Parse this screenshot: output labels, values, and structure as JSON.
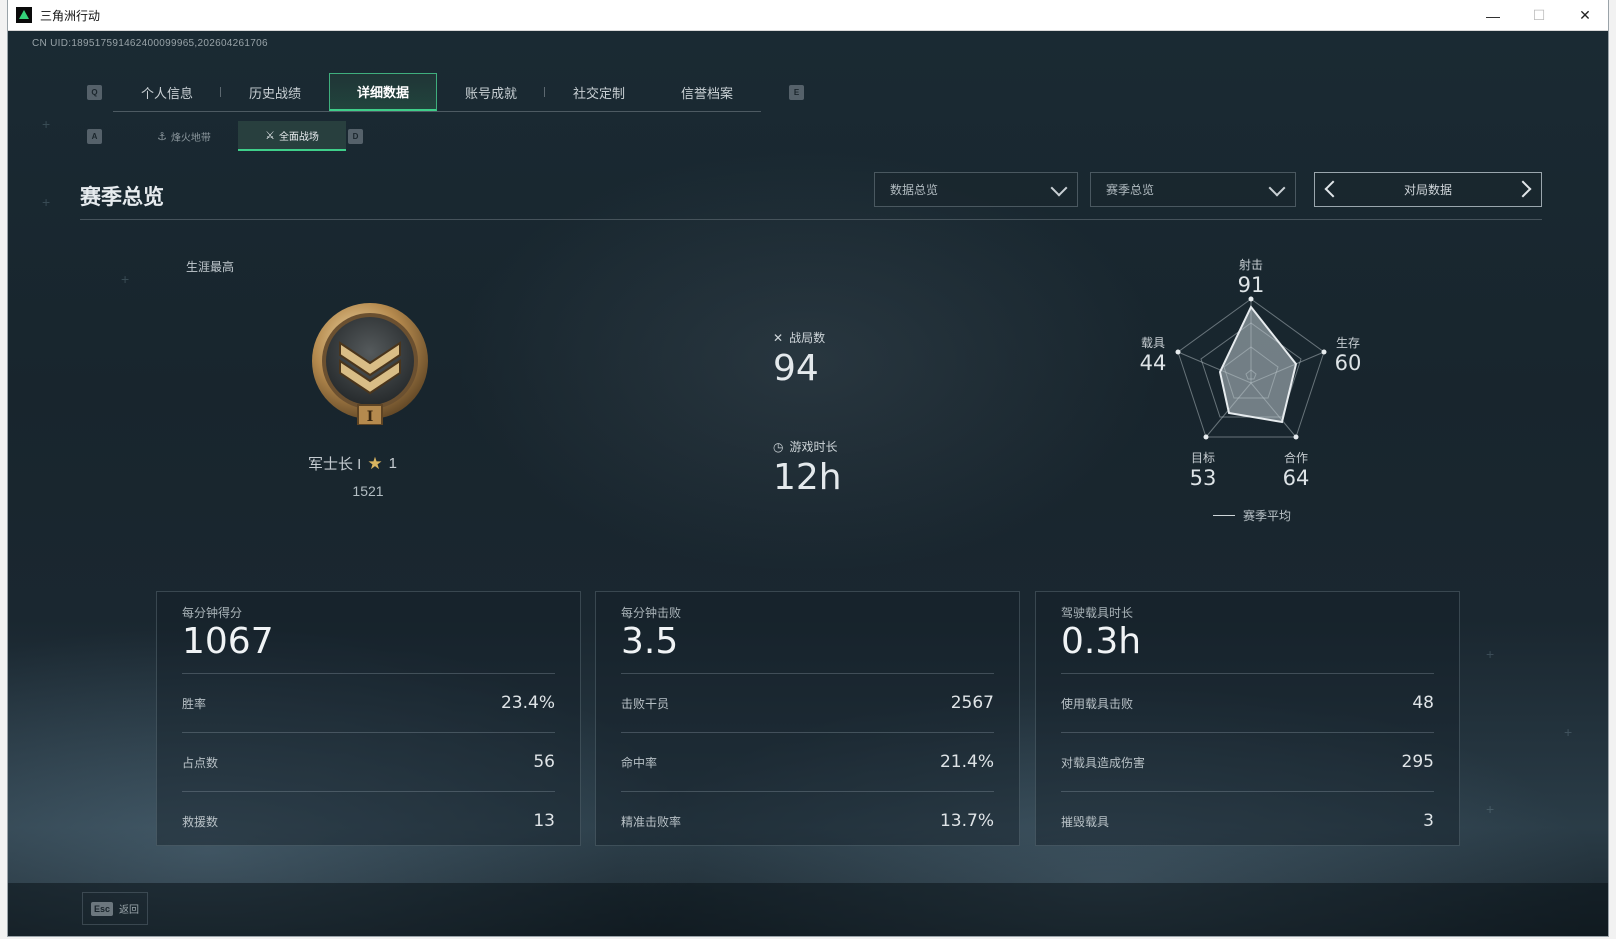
{
  "window": {
    "title": "三角洲行动",
    "minimize_icon": "minimize-icon",
    "maximize_icon": "maximize-icon",
    "close_icon": "close-icon"
  },
  "header": {
    "uid": "CN UID:1895175914624000999​65,202604261706"
  },
  "keys": {
    "prev_tab": "Q",
    "next_tab": "E",
    "prev_sub": "A",
    "next_sub": "D",
    "esc": "Esc"
  },
  "tabs": [
    {
      "label": "个人信息",
      "active": false
    },
    {
      "label": "历史战绩",
      "active": false
    },
    {
      "label": "详细数据",
      "active": true
    },
    {
      "label": "账号成就",
      "active": false
    },
    {
      "label": "社交定制",
      "active": false
    },
    {
      "label": "信誉档案",
      "active": false
    }
  ],
  "subtabs": [
    {
      "label": "烽火地带",
      "active": false
    },
    {
      "label": "全面战场",
      "active": true
    }
  ],
  "section": {
    "title": "赛季总览"
  },
  "filters": {
    "data_dropdown": "数据总览",
    "season_dropdown": "赛季总览",
    "pager_label": "对局数据"
  },
  "rank": {
    "career_label": "生涯最高",
    "name": "军士长 I",
    "stars": "1",
    "score": "1521"
  },
  "summary": {
    "matches_label": "战局数",
    "matches_value": "94",
    "playtime_label": "游戏时长",
    "playtime_value": "12h"
  },
  "radar": {
    "axes": [
      {
        "name": "射击",
        "value": "91"
      },
      {
        "name": "生存",
        "value": "60"
      },
      {
        "name": "合作",
        "value": "64"
      },
      {
        "name": "目标",
        "value": "53"
      },
      {
        "name": "载具",
        "value": "44"
      }
    ],
    "legend": "赛季平均"
  },
  "cards": [
    {
      "head_label": "每分钟得分",
      "head_value": "1067",
      "rows": [
        {
          "k": "胜率",
          "v": "23.4%"
        },
        {
          "k": "占点数",
          "v": "56"
        },
        {
          "k": "救援数",
          "v": "13"
        }
      ]
    },
    {
      "head_label": "每分钟击败",
      "head_value": "3.5",
      "rows": [
        {
          "k": "击败干员",
          "v": "2567"
        },
        {
          "k": "命中率",
          "v": "21.4%"
        },
        {
          "k": "精准击败率",
          "v": "13.7%"
        }
      ]
    },
    {
      "head_label": "驾驶载具时长",
      "head_value": "0.3h",
      "rows": [
        {
          "k": "使用载具击败",
          "v": "48"
        },
        {
          "k": "对载具造成伤害",
          "v": "295"
        },
        {
          "k": "摧毁载具",
          "v": "3"
        }
      ]
    }
  ],
  "footer": {
    "back_label": "返回"
  }
}
